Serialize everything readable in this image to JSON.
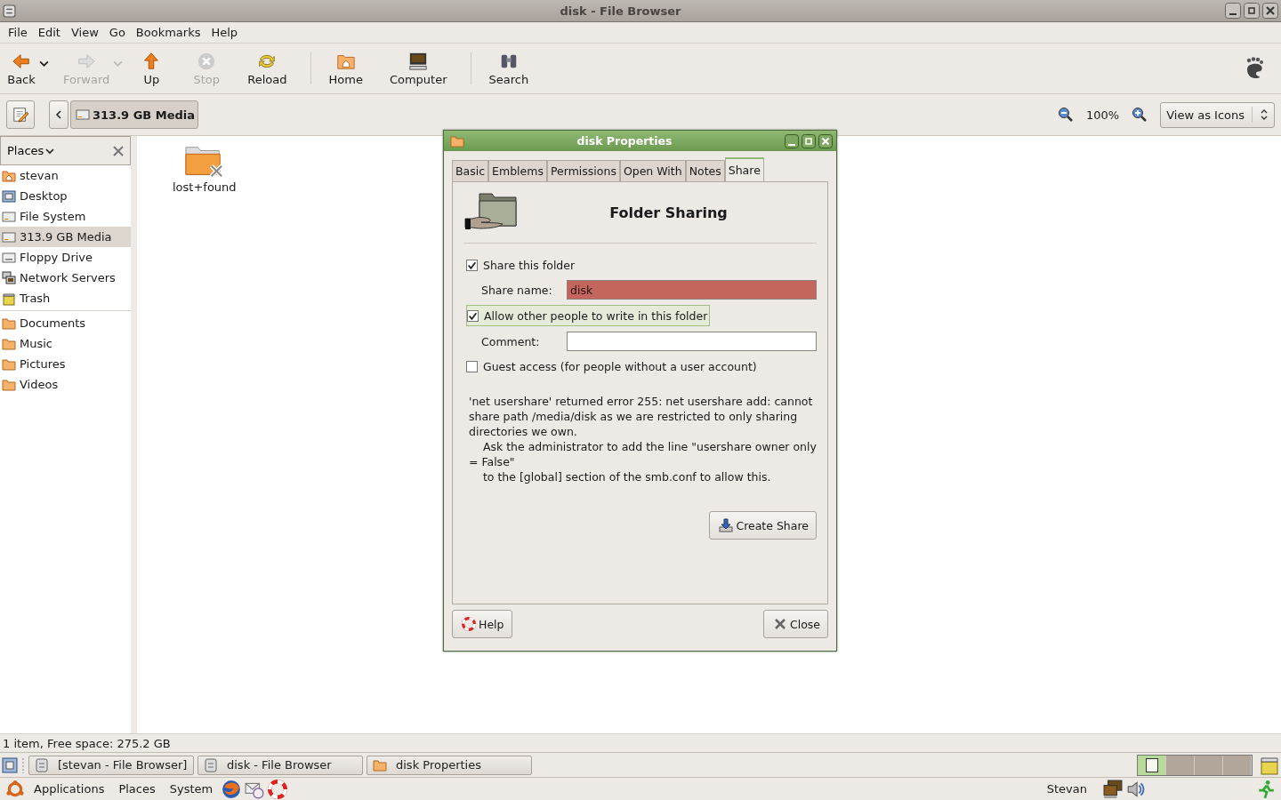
{
  "window": {
    "title": "disk - File Browser"
  },
  "menu": [
    "File",
    "Edit",
    "View",
    "Go",
    "Bookmarks",
    "Help"
  ],
  "toolbar": [
    {
      "kind": "back",
      "label": "Back",
      "disabled": false,
      "has_menu": true
    },
    {
      "kind": "forward",
      "label": "Forward",
      "disabled": true,
      "has_menu": true
    },
    {
      "kind": "up",
      "label": "Up",
      "disabled": false,
      "has_menu": false
    },
    {
      "kind": "stop",
      "label": "Stop",
      "disabled": true,
      "has_menu": false
    },
    {
      "kind": "reload",
      "label": "Reload",
      "disabled": false,
      "has_menu": false
    },
    {
      "kind": "home",
      "label": "Home",
      "disabled": false,
      "has_menu": false
    },
    {
      "kind": "computer",
      "label": "Computer",
      "disabled": false,
      "has_menu": false
    },
    {
      "kind": "search",
      "label": "Search",
      "disabled": false,
      "has_menu": false
    }
  ],
  "location": {
    "path": "313.9 GB Media",
    "zoom": "100%",
    "view": "View as Icons"
  },
  "sidebar": {
    "title": "Places",
    "groups": [
      [
        {
          "kind": "home",
          "label": "stevan",
          "selected": false
        },
        {
          "kind": "desktop",
          "label": "Desktop",
          "selected": false
        },
        {
          "kind": "drive",
          "label": "File System",
          "selected": false
        },
        {
          "kind": "drive",
          "label": "313.9 GB Media",
          "selected": true
        },
        {
          "kind": "floppy",
          "label": "Floppy Drive",
          "selected": false
        },
        {
          "kind": "network",
          "label": "Network Servers",
          "selected": false
        },
        {
          "kind": "trash",
          "label": "Trash",
          "selected": false
        }
      ],
      [
        {
          "kind": "folder",
          "label": "Documents",
          "selected": false
        },
        {
          "kind": "folder",
          "label": "Music",
          "selected": false
        },
        {
          "kind": "folder",
          "label": "Pictures",
          "selected": false
        },
        {
          "kind": "folder",
          "label": "Videos",
          "selected": false
        }
      ]
    ]
  },
  "files": [
    {
      "name": "lost+found"
    }
  ],
  "status_bar": "1 item, Free space: 275.2 GB",
  "dialog": {
    "title": "disk Properties",
    "tabs": [
      {
        "label": "Basic",
        "selected": false
      },
      {
        "label": "Emblems",
        "selected": false
      },
      {
        "label": "Permissions",
        "selected": false
      },
      {
        "label": "Open With",
        "selected": false
      },
      {
        "label": "Notes",
        "selected": false
      },
      {
        "label": "Share",
        "selected": true
      }
    ],
    "heading": "Folder Sharing",
    "share_folder": {
      "label": "Share this folder",
      "checked": true
    },
    "share_name": {
      "label": "Share name:",
      "value": "disk",
      "invalid": true
    },
    "allow_write": {
      "label": "Allow other people to write in this folder",
      "checked": true
    },
    "comment": {
      "label": "Comment:"
    },
    "guest": {
      "label": "Guest access (for people without a user account)",
      "checked": false
    },
    "error": "'net usershare' returned error 255: net usershare add: cannot share path /media/disk as we are restricted to only sharing directories we own.\n\tAsk the administrator to add the line \"usershare owner only = False\"\n\tto the [global] section of the smb.conf to allow this.",
    "create_button": "Create Share",
    "help_button": "Help",
    "close_button": "Close"
  },
  "taskbar": {
    "tasks": [
      {
        "label": "[stevan - File Browser]",
        "kind": "window"
      },
      {
        "label": "disk - File Browser",
        "kind": "window"
      },
      {
        "label": "disk Properties",
        "kind": "folder"
      }
    ],
    "workspaces": [
      {
        "selected": true
      },
      {
        "selected": false
      },
      {
        "selected": false
      },
      {
        "selected": false
      }
    ]
  },
  "panel": {
    "menus": [
      "Applications",
      "Places",
      "System"
    ],
    "user": "Stevan"
  }
}
